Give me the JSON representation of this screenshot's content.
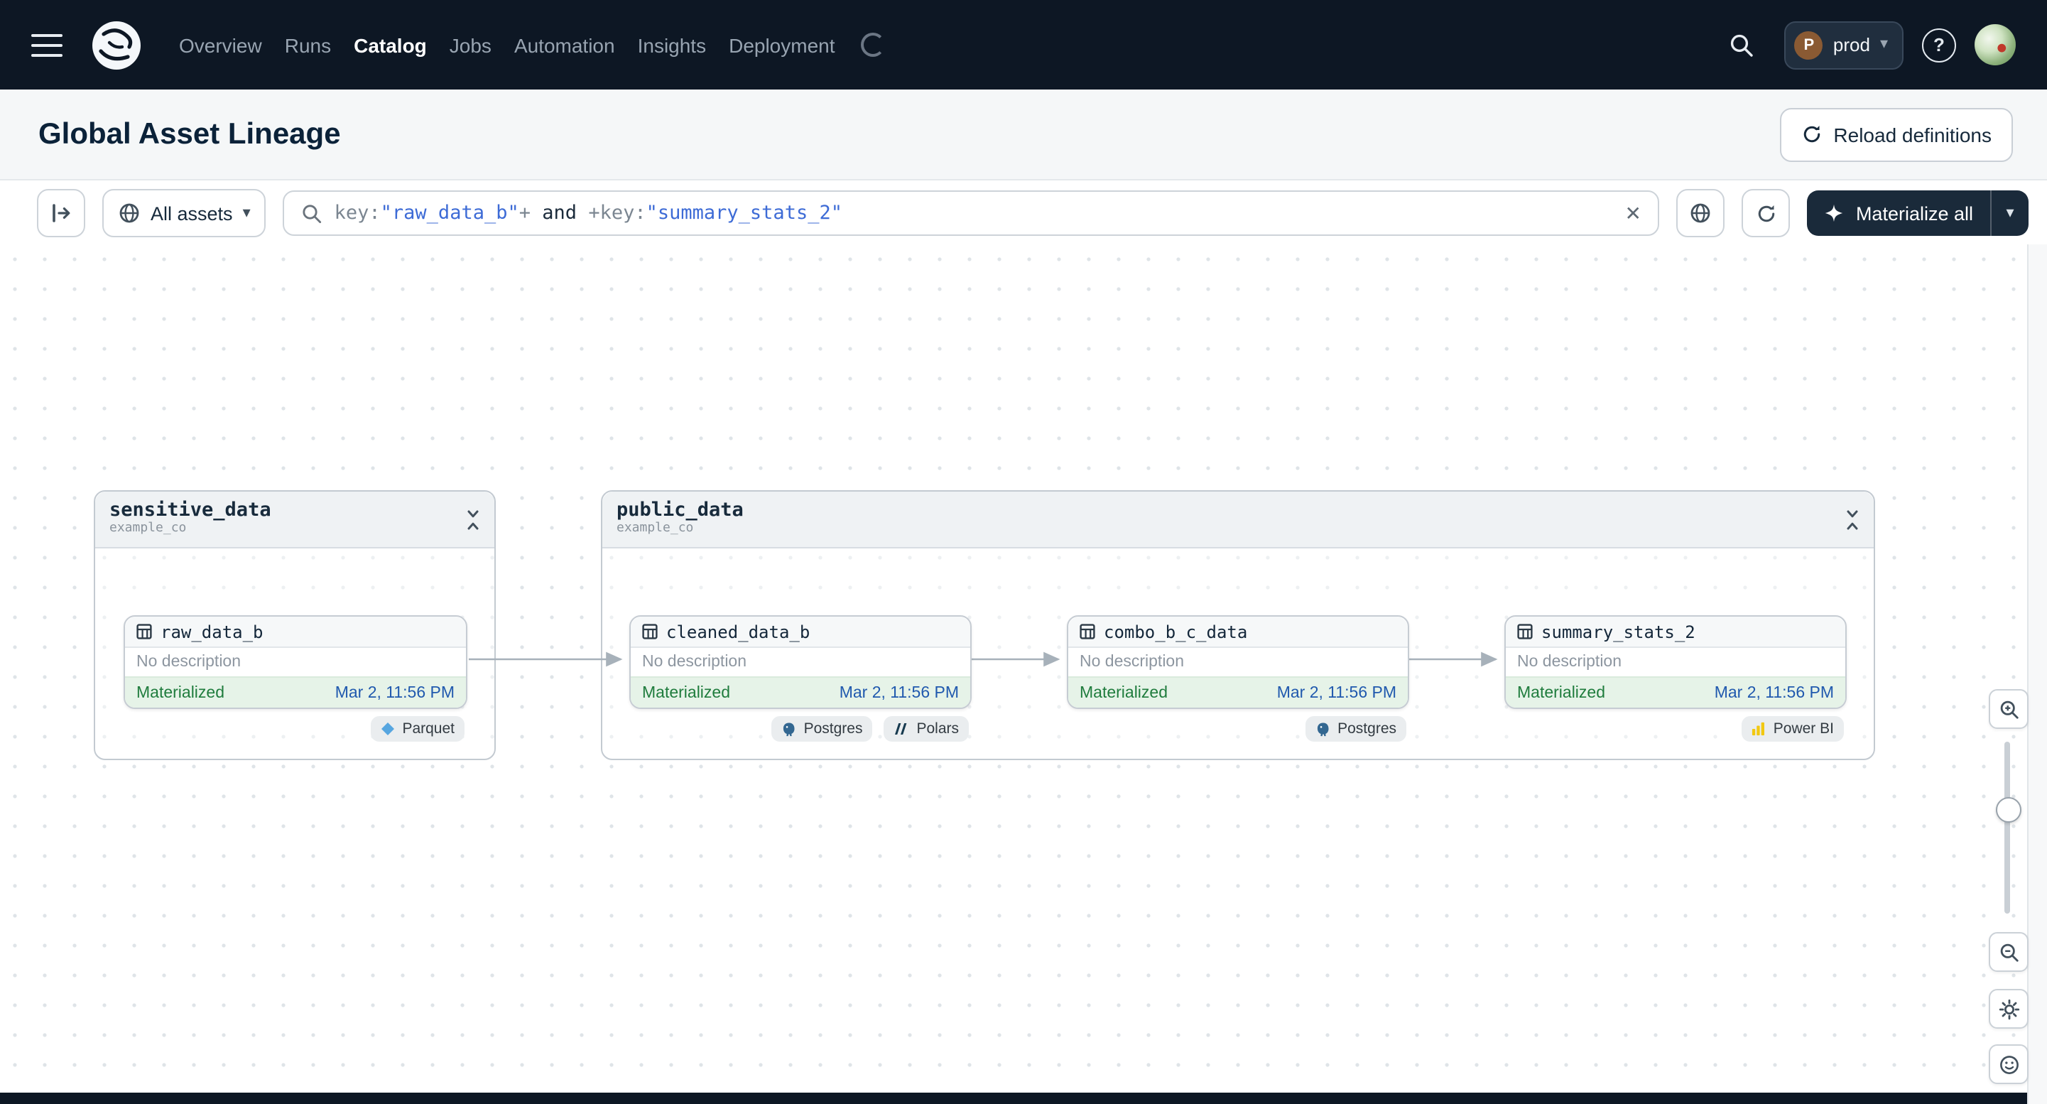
{
  "nav": {
    "items": [
      {
        "label": "Overview",
        "active": false
      },
      {
        "label": "Runs",
        "active": false
      },
      {
        "label": "Catalog",
        "active": true
      },
      {
        "label": "Jobs",
        "active": false
      },
      {
        "label": "Automation",
        "active": false
      },
      {
        "label": "Insights",
        "active": false
      },
      {
        "label": "Deployment",
        "active": false
      }
    ]
  },
  "deployment_switcher": {
    "initial": "P",
    "label": "prod"
  },
  "header": {
    "title": "Global Asset Lineage",
    "reload_label": "Reload definitions"
  },
  "toolbar": {
    "scope_label": "All assets",
    "materialize_label": "Materialize all",
    "query_segments": [
      {
        "text": "key:",
        "style": "key"
      },
      {
        "text": "\"raw_data_b\"",
        "style": "value"
      },
      {
        "text": "+",
        "style": "op"
      },
      {
        "text": " and ",
        "style": "keyword"
      },
      {
        "text": "+",
        "style": "op"
      },
      {
        "text": "key:",
        "style": "key"
      },
      {
        "text": "\"summary_stats_2\"",
        "style": "value"
      }
    ]
  },
  "canvas": {
    "groups": [
      {
        "title": "sensitive_data",
        "subtitle": "example_co"
      },
      {
        "title": "public_data",
        "subtitle": "example_co"
      }
    ],
    "nodes": [
      {
        "name": "raw_data_b",
        "description": "No description",
        "status": "Materialized",
        "timestamp": "Mar 2, 11:56 PM",
        "tags": [
          {
            "label": "Parquet"
          }
        ]
      },
      {
        "name": "cleaned_data_b",
        "description": "No description",
        "status": "Materialized",
        "timestamp": "Mar 2, 11:56 PM",
        "tags": [
          {
            "label": "Postgres"
          },
          {
            "label": "Polars"
          }
        ]
      },
      {
        "name": "combo_b_c_data",
        "description": "No description",
        "status": "Materialized",
        "timestamp": "Mar 2, 11:56 PM",
        "tags": [
          {
            "label": "Postgres"
          }
        ]
      },
      {
        "name": "summary_stats_2",
        "description": "No description",
        "status": "Materialized",
        "timestamp": "Mar 2, 11:56 PM",
        "tags": [
          {
            "label": "Power BI"
          }
        ]
      }
    ]
  },
  "icons": {
    "caret_down": "▾",
    "close": "✕",
    "help": "?"
  },
  "colors": {
    "nav_bg": "#0D1724",
    "status_green": "#1F7C3D",
    "status_bg": "#E6F3E8",
    "timestamp_blue": "#2059AE",
    "query_value_blue": "#3D6BD6",
    "edge_gray": "#A7B1BA"
  }
}
